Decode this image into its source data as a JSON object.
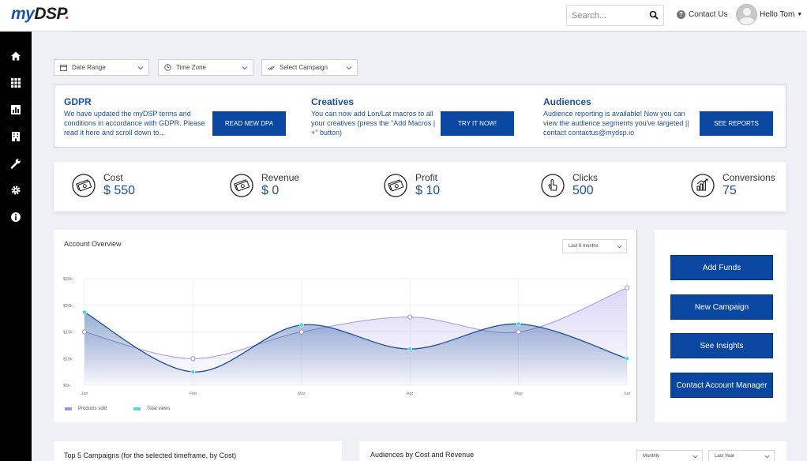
{
  "app": {
    "logo": {
      "part1": "my",
      "part2": "DSP",
      "dot": "."
    },
    "search_placeholder": "Search...",
    "contact_label": "Contact Us",
    "user_greeting": "Hello Tom"
  },
  "sidebar": {
    "items": [
      {
        "icon": "home-icon"
      },
      {
        "icon": "grid-icon"
      },
      {
        "icon": "bar-chart-icon"
      },
      {
        "icon": "building-icon"
      },
      {
        "icon": "wrench-icon"
      },
      {
        "icon": "gear-icon"
      },
      {
        "icon": "info-icon"
      }
    ]
  },
  "filters": {
    "date_range": "Date Range",
    "time_zone": "Time Zone",
    "campaign": "Select Campaign"
  },
  "announcements": [
    {
      "title": "GDPR",
      "text": "We have updated the myDSP terms and conditions in accordance with GDPR. Please read it here and scroll down to...",
      "button": "READ NEW DPA"
    },
    {
      "title": "Creatives",
      "text": "You can now add Lon/Lat macros to all your creatives (press the \"Add Macros | +\" button)",
      "button": "TRY IT NOW!"
    },
    {
      "title": "Audiences",
      "text": "Audience reporting is available! Now you can view the audience segments you've targeted || contact contactus@mydsp.io",
      "button": "SEE REPORTS"
    }
  ],
  "kpis": [
    {
      "label": "Cost",
      "value": "$ 550",
      "icon": "money-icon"
    },
    {
      "label": "Revenue",
      "value": "$ 0",
      "icon": "money-icon"
    },
    {
      "label": "Profit",
      "value": "$ 10",
      "icon": "money-icon"
    },
    {
      "label": "Clicks",
      "value": "500",
      "icon": "pointer-hand-icon"
    },
    {
      "label": "Conversions",
      "value": "75",
      "icon": "growth-chart-icon"
    }
  ],
  "account_overview": {
    "title": "Account Overview",
    "period_select": "Last 6 months"
  },
  "chart_data": {
    "type": "area",
    "title": "Account Overview",
    "categories": [
      "Jan",
      "Feb",
      "Mar",
      "Apr",
      "May",
      "Jun"
    ],
    "y_ticks": [
      "$5k",
      "$10k",
      "$15k",
      "$20k",
      "$25k"
    ],
    "ylim": [
      5000,
      25000
    ],
    "series": [
      {
        "name": "Products sold",
        "color": "#9f8fe3",
        "values": [
          15000,
          10000,
          15000,
          17800,
          15000,
          23300
        ]
      },
      {
        "name": "Total views",
        "color": "#4dd6e8",
        "values": [
          18700,
          7500,
          16300,
          11800,
          16500,
          10000
        ]
      }
    ],
    "grid": true,
    "legend": "bottom-left"
  },
  "actions": [
    "Add Funds",
    "New Campaign",
    "See Insights",
    "Contact Account Manager"
  ],
  "bottom": {
    "campaigns_title": "Top 5 Campaigns (for the selected timeframe, by Cost)",
    "audiences_title": "Audiences by Cost and Revenue",
    "interval_select": "Monthly",
    "period_select": "Last Year"
  }
}
